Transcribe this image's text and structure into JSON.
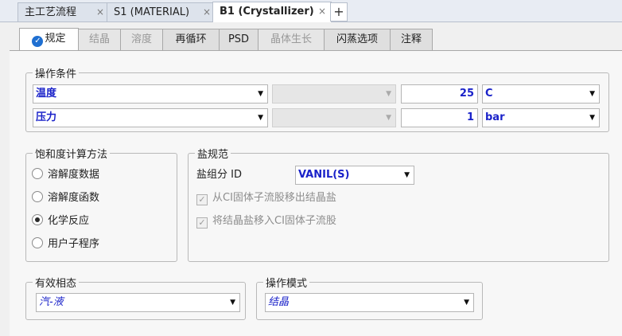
{
  "doc_tabs": [
    {
      "label": "主工艺流程",
      "close": "×"
    },
    {
      "label": "S1 (MATERIAL)",
      "close": "×"
    },
    {
      "label": "B1 (Crystallizer)",
      "close": "×"
    }
  ],
  "doc_add": "+",
  "form_tabs": [
    {
      "label": "规定",
      "icon": "check-circle-icon"
    },
    {
      "label": "结晶"
    },
    {
      "label": "溶度"
    },
    {
      "label": "再循环"
    },
    {
      "label": "PSD"
    },
    {
      "label": "晶体生长"
    },
    {
      "label": "闪蒸选项"
    },
    {
      "label": "注释"
    }
  ],
  "operating_conditions": {
    "title": "操作条件",
    "rows": [
      {
        "variable": "温度",
        "value": "25",
        "unit": "C"
      },
      {
        "variable": "压力",
        "value": "1",
        "unit": "bar"
      }
    ]
  },
  "saturation": {
    "title": "饱和度计算方法",
    "options": [
      "溶解度数据",
      "溶解度函数",
      "化学反应",
      "用户子程序"
    ],
    "selected": "化学反应"
  },
  "salt_spec": {
    "title": "盐规范",
    "component_label": "盐组分 ID",
    "component_value": "VANIL(S)",
    "checkbox1": "从CI固体子流股移出结晶盐",
    "checkbox2": "将结晶盐移入CI固体子流股"
  },
  "valid_phases": {
    "title": "有效相态",
    "value": "汽-液"
  },
  "operation_mode": {
    "title": "操作模式",
    "value": "结晶"
  },
  "icons": {
    "dropdown": "▼",
    "check": "✓"
  }
}
